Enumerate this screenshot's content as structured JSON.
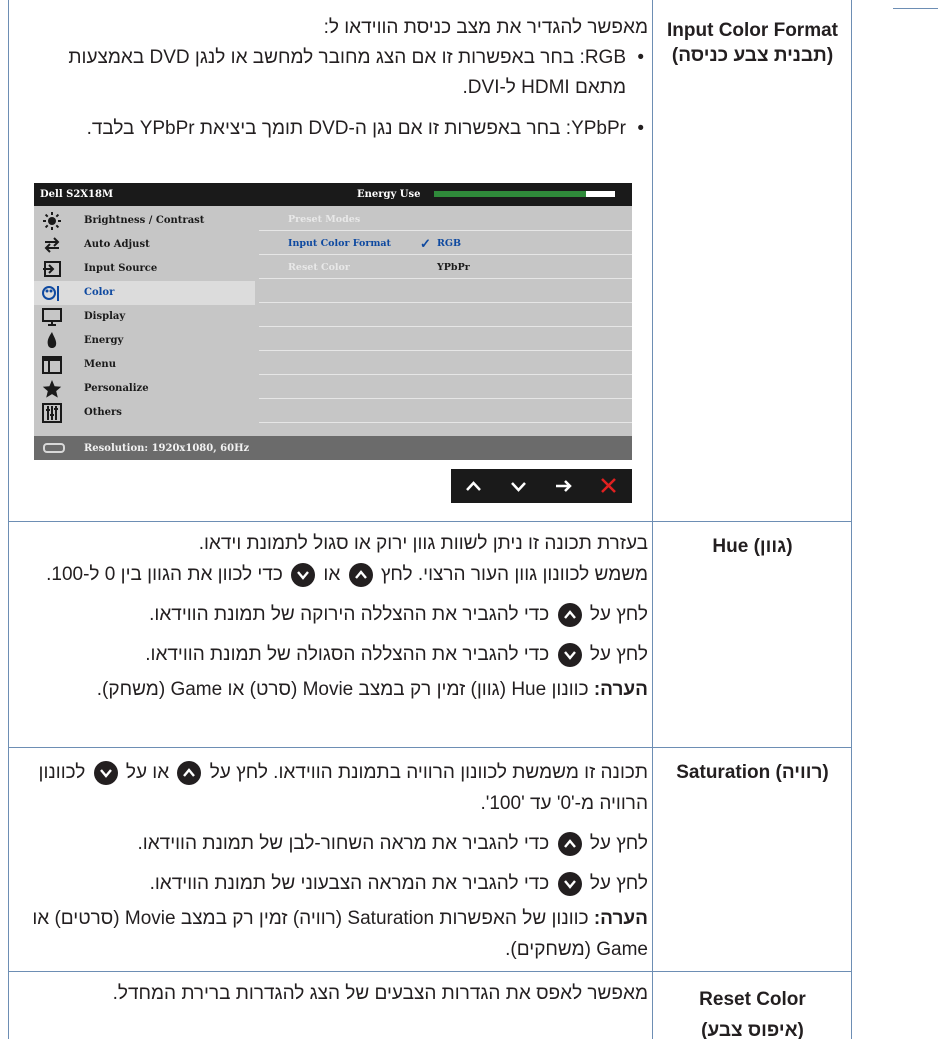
{
  "rows": [
    {
      "label_en": "Input Color Format",
      "label_he": "(תבנית צבע כניסה)",
      "intro": "מאפשר להגדיר את מצב כניסת הווידאו ל:",
      "bullet1_a": "RGB",
      "bullet1_b": ": בחר באפשרות זו אם הצג מחובר למחשב או לנגן DVD באמצעות מתאם HDMI ל-DVI.",
      "bullet2": "YPbPr: בחר באפשרות זו אם נגן ה-DVD תומך ביציאת YPbPr בלבד."
    },
    {
      "label": "Hue (גוון)",
      "p1": "בעזרת תכונה זו ניתן לשוות גוון ירוק או סגול לתמונת וידאו.",
      "p2_a": "משמש לכוונון גוון העור הרצוי. לחץ",
      "p2_b": "או",
      "p2_c": "כדי לכוון את הגוון בין 0 ל-100.",
      "p3_a": "לחץ על",
      "p3_b": "כדי להגביר את ההצללה הירוקה של תמונת הווידאו.",
      "p4_a": "לחץ על",
      "p4_b": "כדי להגביר את ההצללה הסגולה של תמונת הווידאו.",
      "note_label": "הערה:",
      "note_text": " כוונון Hue (גוון) זמין רק במצב Movie (סרט) או Game (משחק)."
    },
    {
      "label": "Saturation (רוויה)",
      "p1_a": "תכונה זו משמשת לכוונון הרוויה בתמונת הווידאו. לחץ על",
      "p1_b": "או על",
      "p1_c": "לכוונון הרוויה מ-'0' עד '100'.",
      "p2_a": "לחץ על",
      "p2_b": "כדי להגביר את מראה השחור-לבן של תמונת הווידאו.",
      "p3_a": "לחץ על",
      "p3_b": "כדי להגביר את המראה הצבעוני של תמונת הווידאו.",
      "note_label": "הערה:",
      "note_text": " כוונון של האפשרות Saturation (רוויה) זמין רק במצב Movie (סרטים) או Game (משחקים)."
    },
    {
      "label_en": "Reset Color",
      "label_he": "(איפוס צבע)",
      "text": "מאפשר לאפס את הגדרות הצבעים של הצג להגדרות ברירת המחדל."
    }
  ],
  "osd": {
    "model": "Dell S2X18M",
    "energy_label": "Energy Use",
    "energy_level": 0.84,
    "menu_items": [
      "Brightness / Contrast",
      "Auto Adjust",
      "Input Source",
      "Color",
      "Display",
      "Energy",
      "Menu",
      "Personalize",
      "Others"
    ],
    "menu_icons": [
      "brightness-icon",
      "auto-adjust-icon",
      "input-source-icon",
      "color-icon",
      "display-icon",
      "energy-icon",
      "menu-icon",
      "personalize-icon",
      "others-icon"
    ],
    "active_item": "Color",
    "options": {
      "preset_modes": "Preset Modes",
      "input_color_format": "Input Color Format",
      "check": "✓",
      "rgb": "RGB",
      "reset_color": "Reset Color",
      "ypbpr": "YPbPr"
    },
    "resolution": "Resolution: 1920x1080, 60Hz",
    "nav_buttons": [
      "up-icon",
      "down-icon",
      "enter-icon",
      "close-icon"
    ]
  },
  "colors": {
    "border": "#6d8eb4",
    "text": "#231f20",
    "osd_active": "#0e49a0",
    "energy_bar": "#2f8a3a",
    "close_red": "#e02020"
  }
}
